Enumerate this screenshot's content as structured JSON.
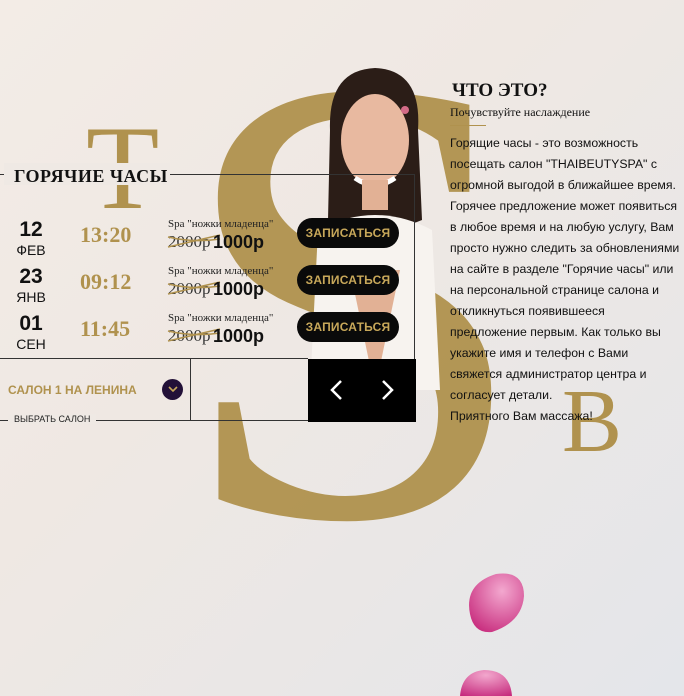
{
  "decor": {
    "big_letter": "S",
    "letter_t": "T",
    "letter_b": "B"
  },
  "hot_hours": {
    "title": "ГОРЯЧИЕ ЧАСЫ",
    "offers": [
      {
        "day": "12",
        "month": "ФЕВ",
        "time": "13:20",
        "service": "Spa \"ножки младенца\"",
        "old_price": "2000р",
        "new_price": "1000р",
        "button": "ЗАПИСАТЬСЯ"
      },
      {
        "day": "23",
        "month": "ЯНВ",
        "time": "09:12",
        "service": "Spa \"ножки младенца\"",
        "old_price": "2000р",
        "new_price": "1000р",
        "button": "ЗАПИСАТЬСЯ"
      },
      {
        "day": "01",
        "month": "СЕН",
        "time": "11:45",
        "service": "Spa \"ножки младенца\"",
        "old_price": "2000р",
        "new_price": "1000р",
        "button": "ЗАПИСАТЬСЯ"
      }
    ],
    "salon_select": {
      "value": "САЛОН 1 НА ЛЕНИНА",
      "hint": "ВЫБРАТЬ САЛОН"
    },
    "nav": {
      "prev_icon": "chevron-left-icon",
      "next_icon": "chevron-right-icon"
    }
  },
  "about": {
    "title": "ЧТО ЭТО?",
    "subtitle": "Почувствуйте наслаждение",
    "body": "Горящие часы - это возможность посещать салон \"THAIBEUTYSPA\" с огромной выгодой в ближайшее время. Горячее предложение может появиться в любое время и на любую услугу, Вам просто нужно следить за обновлениями на сайте в разделе \"Горячие часы\" или на персональной странице салона и откликнуться появившееся предложение первым. Как только вы укажите имя и телефон с Вами свяжется администратор центра и согласует детали.",
    "closing": "Приятного Вам массажа!"
  },
  "colors": {
    "gold": "#b0924e",
    "dark": "#0a0a0a",
    "chevron_bg": "#231138"
  }
}
